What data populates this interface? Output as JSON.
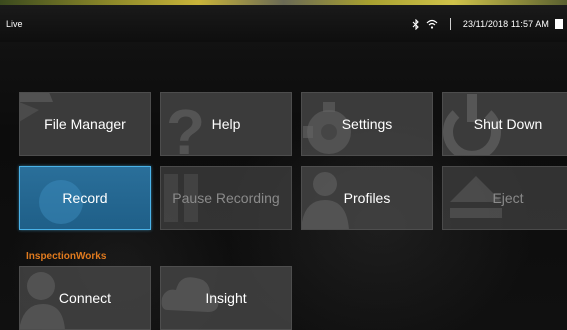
{
  "status": {
    "mode": "Live",
    "datetime": "23/11/2018 11:57 AM"
  },
  "tiles": {
    "file_manager": "File Manager",
    "help": "Help",
    "settings": "Settings",
    "shut_down": "Shut Down",
    "record": "Record",
    "pause_recording": "Pause Recording",
    "profiles": "Profiles",
    "eject": "Eject",
    "connect": "Connect",
    "insight": "Insight"
  },
  "section": {
    "inspectionworks": "InspectionWorks"
  },
  "colors": {
    "accent_blue": "#2a6f9a",
    "accent_border": "#4ab2e8",
    "section_orange": "#e07a1e",
    "tile_gray": "#464646"
  }
}
